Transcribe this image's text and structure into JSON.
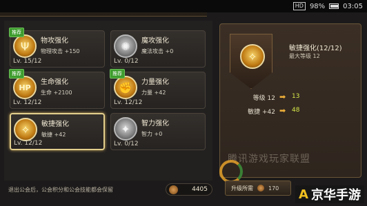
{
  "status_bar": {
    "hd": "HD",
    "battery": "98%",
    "time": "03:05"
  },
  "header": {
    "back": "◀"
  },
  "cards": [
    {
      "title": "物攻强化",
      "stat": "物理攻击 +150",
      "level": "Lv. 15/12",
      "badge": "推荐",
      "icon": "trident-icon",
      "tone": "gold",
      "glyph": "Ψ"
    },
    {
      "title": "魔攻强化",
      "stat": "魔法攻击 +0",
      "level": "Lv. 0/12",
      "badge": "",
      "icon": "swirl-icon",
      "tone": "grey",
      "glyph": "✺"
    },
    {
      "title": "生命强化",
      "stat": "生命 +2100",
      "level": "Lv. 12/12",
      "badge": "推荐",
      "icon": "hp-icon",
      "tone": "gold",
      "glyph": "HP"
    },
    {
      "title": "力量强化",
      "stat": "力量 +42",
      "level": "Lv. 12/12",
      "badge": "推荐",
      "icon": "strength-icon",
      "tone": "gold",
      "glyph": "✊"
    },
    {
      "title": "敏捷强化",
      "stat": "敏捷 +42",
      "level": "Lv. 12/12",
      "badge": "",
      "icon": "agility-icon",
      "tone": "gold",
      "glyph": "✧"
    },
    {
      "title": "智力强化",
      "stat": "智力 +0",
      "level": "Lv. 0/12",
      "badge": "",
      "icon": "intellect-icon",
      "tone": "grey",
      "glyph": "✦"
    }
  ],
  "footer": {
    "note": "退出公会后，公会积分和公会技能都会保留",
    "points": "4405"
  },
  "detail": {
    "title": "敏捷强化(12/12)",
    "max_level": "最大等级 12",
    "rows": [
      {
        "label": "等级 12",
        "value": "13"
      },
      {
        "label": "敏捷 +42",
        "value": "48"
      }
    ],
    "arrow": "➡",
    "icon_glyph": "✧"
  },
  "upgrade": {
    "label": "升级所需",
    "cost": "170"
  },
  "watermark": {
    "text": "腾讯游戏玩家联盟"
  },
  "site_logo": {
    "text": "京华手游",
    "mark": "A"
  },
  "colors": {
    "accent_gold": "#e3cf8d",
    "value_green": "#d7e84a",
    "badge_green": "#3e9d2e"
  }
}
